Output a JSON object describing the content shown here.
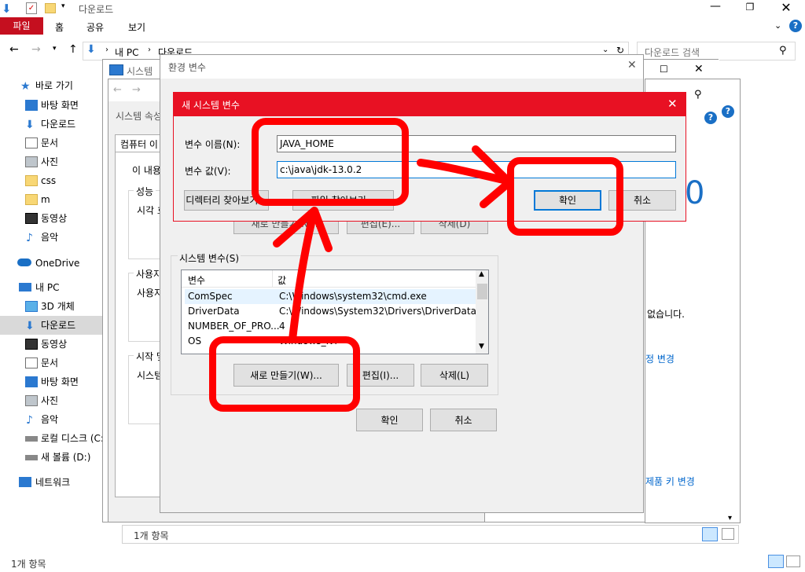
{
  "explorer": {
    "title": "다운로드",
    "ribbon_tabs": [
      "파일",
      "홈",
      "공유",
      "보기"
    ],
    "address": [
      "내 PC",
      "다운로드"
    ],
    "search_placeholder": "다운로드 검색",
    "status_count": "1개 항목",
    "nav": {
      "quick_access": "바로 가기",
      "quick_items": [
        "바탕 화면",
        "다운로드",
        "문서",
        "사진",
        "css",
        "m",
        "동영상",
        "음악"
      ],
      "onedrive": "OneDrive",
      "this_pc": "내 PC",
      "pc_items": [
        "3D 개체",
        "다운로드",
        "동영상",
        "문서",
        "바탕 화면",
        "사진",
        "음악",
        "로컬 디스크 (C:)",
        "새 볼륨 (D:)"
      ],
      "network": "네트워크"
    }
  },
  "system_window": {
    "title": "시스템",
    "side_texts": [
      "없습니다.",
      "정 변경",
      "제품 키 변경"
    ],
    "big_digit": "0",
    "status_count": "1개 항목"
  },
  "sys_props": {
    "title": "시스템 속성",
    "tab": "컴퓨터 이",
    "intro": "이 내용",
    "groups": [
      "성능",
      "사용자",
      "시작 및"
    ],
    "group_texts": [
      "시각 효",
      "사용자",
      "시스템"
    ]
  },
  "env_vars": {
    "title": "환경 변수",
    "system_vars_label": "시스템 변수(S)",
    "columns": [
      "변수",
      "값"
    ],
    "rows": [
      {
        "name": "ComSpec",
        "value": "C:\\Windows\\system32\\cmd.exe"
      },
      {
        "name": "DriverData",
        "value": "C:\\Windows\\System32\\Drivers\\DriverData"
      },
      {
        "name": "NUMBER_OF_PRO...",
        "value": "4"
      },
      {
        "name": "OS",
        "value": "Windows_NT"
      }
    ],
    "user_buttons": [
      "새로 만들기(N)...",
      "편집(E)...",
      "삭제(D)"
    ],
    "sys_buttons": [
      "새로 만들기(W)...",
      "편집(I)...",
      "삭제(L)"
    ],
    "ok": "확인",
    "cancel": "취소"
  },
  "new_var_dialog": {
    "title": "새 시스템 변수",
    "name_label": "변수 이름(N):",
    "value_label": "변수 값(V):",
    "name_value": "JAVA_HOME",
    "value_value": "c:\\java\\jdk-13.0.2",
    "browse_dir": "디렉터리 찾아보기...",
    "browse_file": "파일 찾아보기...",
    "ok": "확인",
    "cancel": "취소"
  },
  "colors": {
    "accent": "#e81123",
    "selection": "#cce8ff",
    "annotation": "#ff0000",
    "link": "#0066cc"
  }
}
